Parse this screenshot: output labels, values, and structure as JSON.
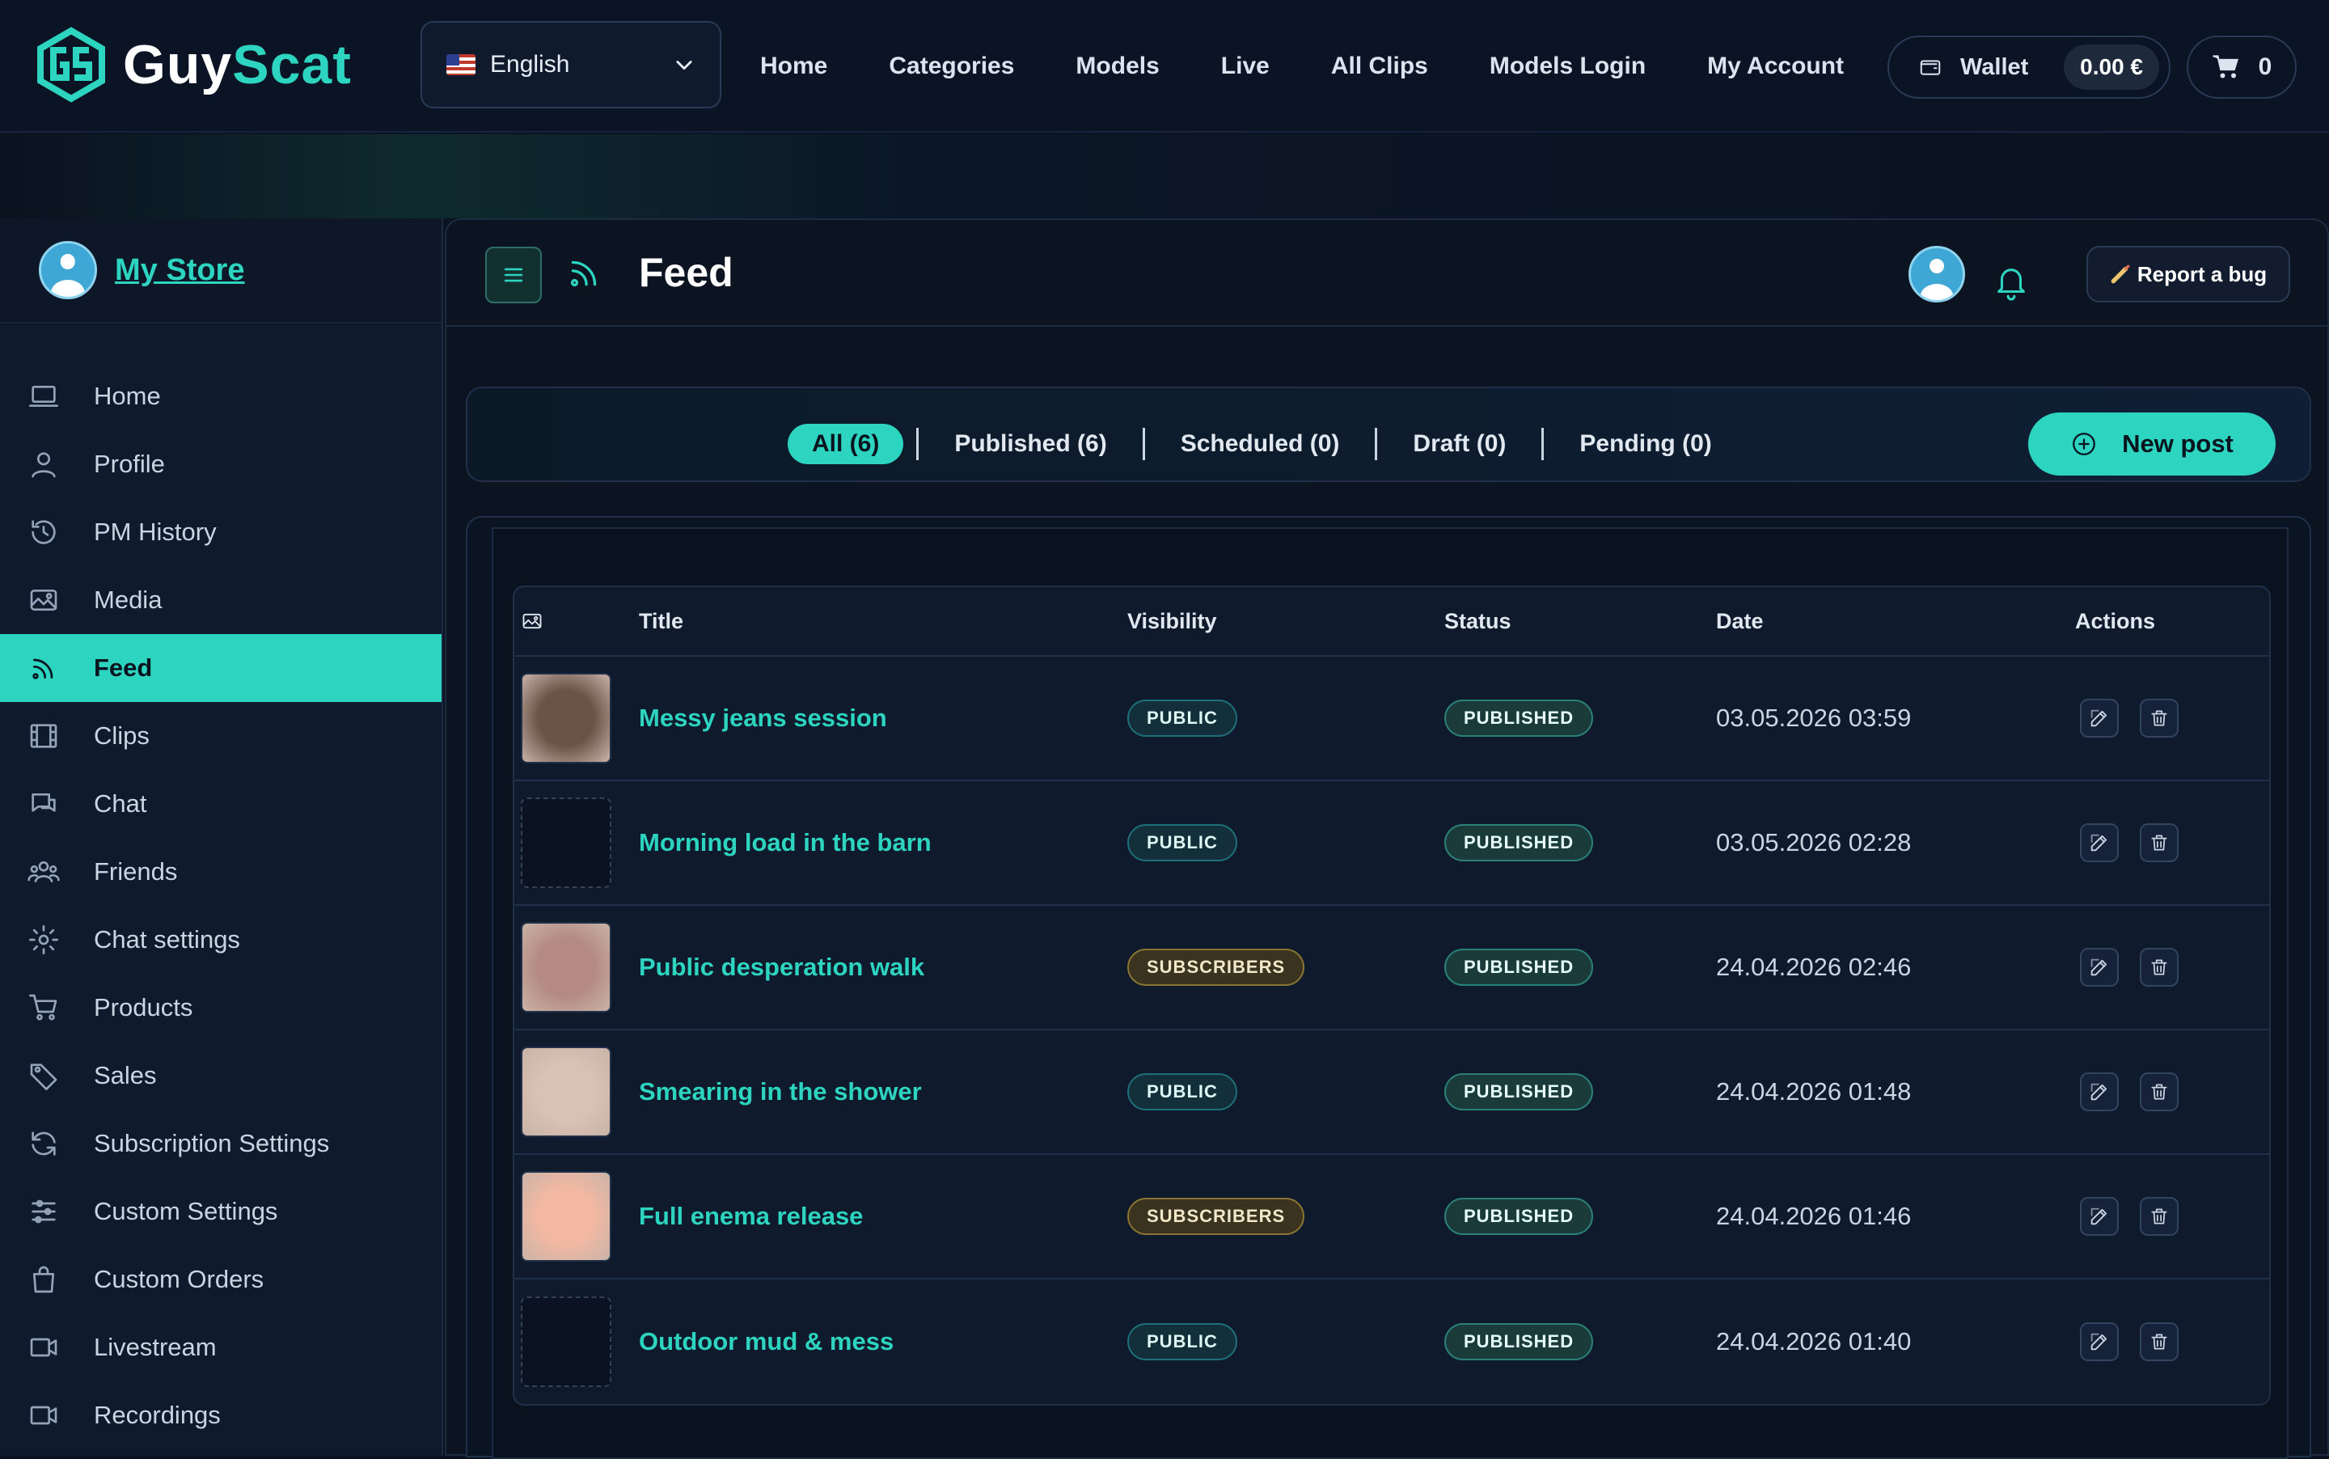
{
  "logo": {
    "part1": "Guy",
    "part2": "Scat"
  },
  "language": {
    "selected": "English"
  },
  "topnav": [
    "Home",
    "Categories",
    "Models",
    "Live",
    "All Clips",
    "Models Login",
    "My Account"
  ],
  "wallet": {
    "label": "Wallet",
    "amount": "0.00 €"
  },
  "cart": {
    "count": "0"
  },
  "sidebar": {
    "store_label": "My Store",
    "items": [
      {
        "label": "Home",
        "icon": "laptop-icon"
      },
      {
        "label": "Profile",
        "icon": "user-icon"
      },
      {
        "label": "PM History",
        "icon": "history-icon"
      },
      {
        "label": "Media",
        "icon": "image-icon"
      },
      {
        "label": "Feed",
        "icon": "rss-icon",
        "active": true
      },
      {
        "label": "Clips",
        "icon": "film-icon"
      },
      {
        "label": "Chat",
        "icon": "chat-icon"
      },
      {
        "label": "Friends",
        "icon": "users-icon"
      },
      {
        "label": "Chat settings",
        "icon": "gear-icon"
      },
      {
        "label": "Products",
        "icon": "cart-icon"
      },
      {
        "label": "Sales",
        "icon": "tag-icon"
      },
      {
        "label": "Subscription Settings",
        "icon": "refresh-icon"
      },
      {
        "label": "Custom Settings",
        "icon": "sliders-icon"
      },
      {
        "label": "Custom Orders",
        "icon": "bag-icon"
      },
      {
        "label": "Livestream",
        "icon": "video-icon"
      },
      {
        "label": "Recordings",
        "icon": "video-icon"
      }
    ]
  },
  "page": {
    "title": "Feed",
    "report_bug": "Report a bug"
  },
  "filters": {
    "tabs": [
      "All (6)",
      "Published (6)",
      "Scheduled (0)",
      "Draft (0)",
      "Pending (0)"
    ],
    "active": "All (6)",
    "new_post": "New post"
  },
  "table": {
    "columns": [
      "Title",
      "Visibility",
      "Status",
      "Date",
      "Actions"
    ],
    "rows": [
      {
        "title": "Messy jeans session",
        "visibility": "PUBLIC",
        "status": "PUBLISHED",
        "date": "03.05.2026 03:59",
        "thumb": "#6b5348"
      },
      {
        "title": "Morning load in the barn",
        "visibility": "PUBLIC",
        "status": "PUBLISHED",
        "date": "03.05.2026 02:28",
        "thumb": ""
      },
      {
        "title": "Public desperation walk",
        "visibility": "SUBSCRIBERS",
        "status": "PUBLISHED",
        "date": "24.04.2026 02:46",
        "thumb": "#b48a83"
      },
      {
        "title": "Smearing in the shower",
        "visibility": "PUBLIC",
        "status": "PUBLISHED",
        "date": "24.04.2026 01:48",
        "thumb": "#d9c2b3"
      },
      {
        "title": "Full enema release",
        "visibility": "SUBSCRIBERS",
        "status": "PUBLISHED",
        "date": "24.04.2026 01:46",
        "thumb": "#f2b8a2"
      },
      {
        "title": "Outdoor mud & mess",
        "visibility": "PUBLIC",
        "status": "PUBLISHED",
        "date": "24.04.2026 01:40",
        "thumb": ""
      }
    ]
  },
  "colors": {
    "accent": "#2dd4bf",
    "background": "#0b1220",
    "panel": "#0f1a2d"
  }
}
